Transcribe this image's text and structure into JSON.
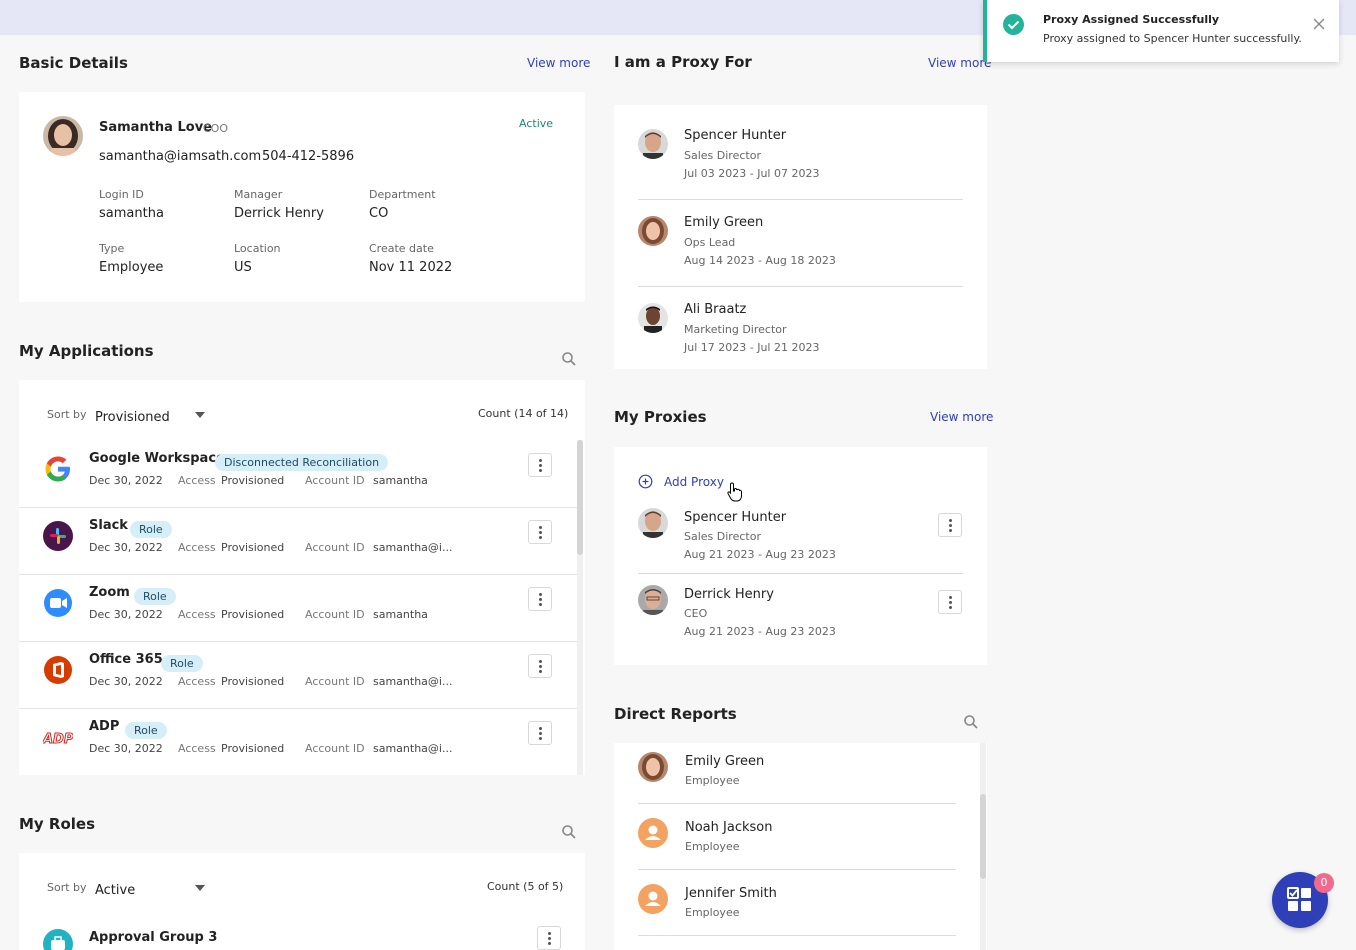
{
  "toast": {
    "title": "Proxy Assigned Successfully",
    "message": "Proxy assigned to Spencer Hunter successfully."
  },
  "basic_details": {
    "title": "Basic Details",
    "view_more": "View more",
    "name": "Samantha Love",
    "role": "COO",
    "status": "Active",
    "email": "samantha@iamsath.com",
    "phone": "504-412-5896",
    "fields": [
      {
        "label": "Login ID",
        "value": "samantha"
      },
      {
        "label": "Manager",
        "value": "Derrick Henry"
      },
      {
        "label": "Department",
        "value": "CO"
      },
      {
        "label": "Type",
        "value": "Employee"
      },
      {
        "label": "Location",
        "value": "US"
      },
      {
        "label": "Create date",
        "value": "Nov 11 2022"
      }
    ]
  },
  "my_applications": {
    "title": "My Applications",
    "sort_label": "Sort by",
    "sort_value": "Provisioned",
    "count": "Count (14 of 14)",
    "access_label": "Access",
    "account_label": "Account ID",
    "items": [
      {
        "name": "Google Workspace",
        "badge": "Disconnected Reconciliation",
        "date": "Dec 30, 2022",
        "access": "Provisioned",
        "account": "samantha",
        "icon": "google-logo"
      },
      {
        "name": "Slack",
        "badge": "Role",
        "date": "Dec 30, 2022",
        "access": "Provisioned",
        "account": "samantha@i...",
        "icon": "slack-logo"
      },
      {
        "name": "Zoom",
        "badge": "Role",
        "date": "Dec 30, 2022",
        "access": "Provisioned",
        "account": "samantha",
        "icon": "zoom-logo"
      },
      {
        "name": "Office 365",
        "badge": "Role",
        "date": "Dec 30, 2022",
        "access": "Provisioned",
        "account": "samantha@i...",
        "icon": "office-logo"
      },
      {
        "name": "ADP",
        "badge": "Role",
        "date": "Dec 30, 2022",
        "access": "Provisioned",
        "account": "samantha@i...",
        "icon": "adp-logo"
      }
    ]
  },
  "my_roles": {
    "title": "My Roles",
    "sort_label": "Sort by",
    "sort_value": "Active",
    "count": "Count (5 of 5)",
    "first_item": "Approval Group 3"
  },
  "proxy_for": {
    "title": "I am a Proxy For",
    "view_more": "View more",
    "items": [
      {
        "name": "Spencer Hunter",
        "title": "Sales Director",
        "dates": "Jul 03 2023 - Jul 07 2023"
      },
      {
        "name": "Emily Green",
        "title": "Ops Lead",
        "dates": "Aug 14 2023 - Aug 18 2023"
      },
      {
        "name": "Ali Braatz",
        "title": "Marketing Director",
        "dates": "Jul 17 2023 - Jul 21 2023"
      }
    ]
  },
  "my_proxies": {
    "title": "My Proxies",
    "view_more": "View more",
    "add_label": "Add Proxy",
    "items": [
      {
        "name": "Spencer Hunter",
        "title": "Sales Director",
        "dates": "Aug 21 2023 - Aug 23 2023"
      },
      {
        "name": "Derrick Henry",
        "title": "CEO",
        "dates": "Aug 21 2023 - Aug 23 2023"
      }
    ]
  },
  "direct_reports": {
    "title": "Direct Reports",
    "items": [
      {
        "name": "Emily Green",
        "type": "Employee"
      },
      {
        "name": "Noah Jackson",
        "type": "Employee"
      },
      {
        "name": "Jennifer Smith",
        "type": "Employee"
      }
    ]
  },
  "fab": {
    "badge": "0"
  },
  "colors": {
    "accent": "#2f3fb8",
    "success": "#23b39a",
    "active": "#1a8a6e",
    "badge_bg": "#d5eef8"
  }
}
